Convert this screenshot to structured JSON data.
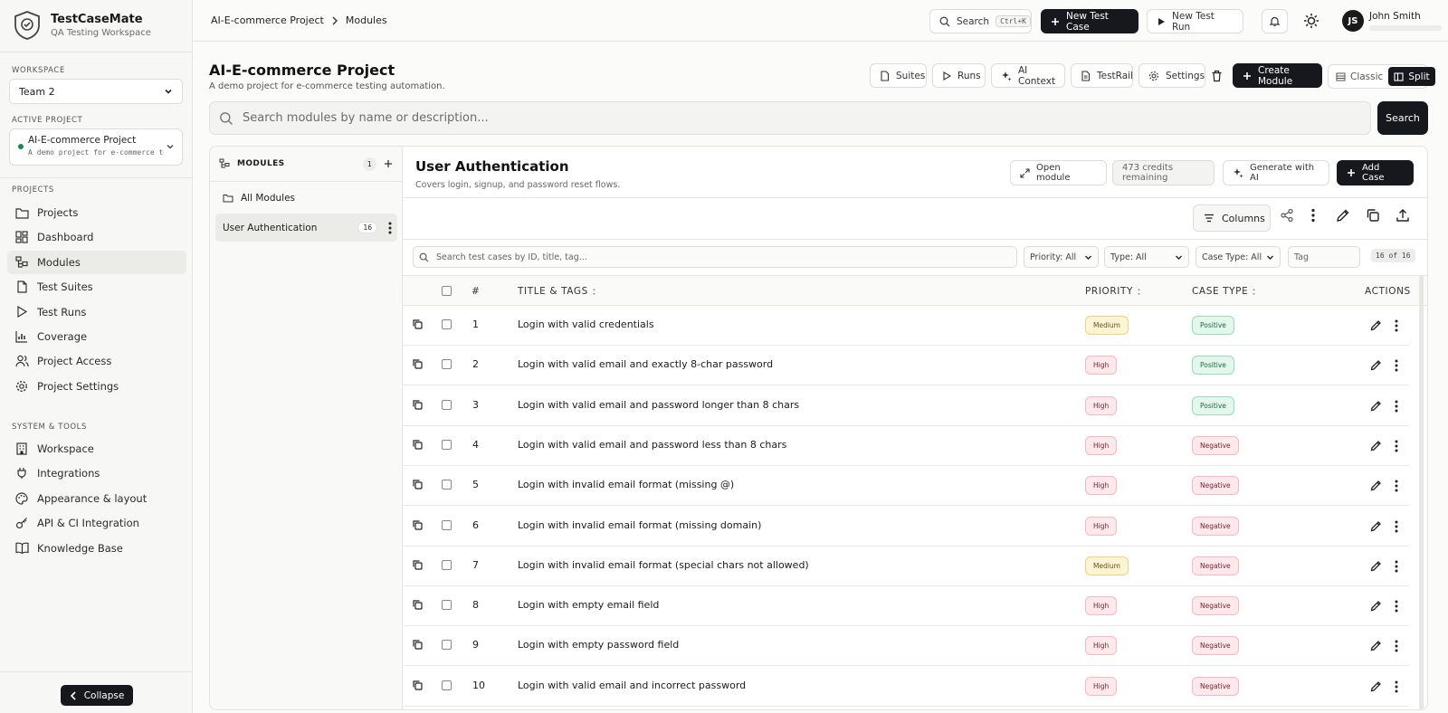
{
  "brand": {
    "name": "TestCaseMate",
    "subtitle": "QA Testing Workspace"
  },
  "sidebar": {
    "workspace_label": "WORKSPACE",
    "workspace_value": "Team 2",
    "active_project_label": "ACTIVE PROJECT",
    "active_project": {
      "name": "AI-E-commerce Project",
      "description": "A demo project for e-commerce testi..."
    },
    "projects_label": "PROJECTS",
    "project_items": [
      {
        "label": "Projects",
        "icon": "folder-icon"
      },
      {
        "label": "Dashboard",
        "icon": "dashboard-icon"
      },
      {
        "label": "Modules",
        "icon": "modules-icon"
      },
      {
        "label": "Test Suites",
        "icon": "suites-icon"
      },
      {
        "label": "Test Runs",
        "icon": "play-icon"
      },
      {
        "label": "Coverage",
        "icon": "chart-icon"
      },
      {
        "label": "Project Access",
        "icon": "users-icon"
      },
      {
        "label": "Project Settings",
        "icon": "gear-icon"
      }
    ],
    "system_label": "SYSTEM & TOOLS",
    "system_items": [
      {
        "label": "Workspace",
        "icon": "building-icon"
      },
      {
        "label": "Integrations",
        "icon": "plug-icon"
      },
      {
        "label": "Appearance & layout",
        "icon": "palette-icon"
      },
      {
        "label": "API & CI Integration",
        "icon": "key-icon"
      },
      {
        "label": "Knowledge Base",
        "icon": "book-icon"
      }
    ],
    "collapse_label": "Collapse"
  },
  "topbar": {
    "breadcrumb": [
      "AI-E-commerce Project",
      "Modules"
    ],
    "search_label": "Search",
    "search_kbd": "Ctrl+K",
    "new_test_case": "New Test Case",
    "new_test_run": "New Test Run",
    "user_initials": "JS",
    "user_name": "John Smith"
  },
  "project": {
    "title": "AI-E-commerce Project",
    "subtitle": "A demo project for e-commerce testing automation.",
    "buttons": {
      "suites": "Suites",
      "runs": "Runs",
      "ai_context": "AI Context",
      "testrail": "TestRail",
      "settings": "Settings",
      "create_module": "Create Module",
      "classic": "Classic",
      "split": "Split"
    },
    "search_placeholder": "Search modules by name or description...",
    "search_button": "Search"
  },
  "modules": {
    "header": "MODULES",
    "count": "1",
    "all_label": "All Modules",
    "items": [
      {
        "label": "User Authentication",
        "count": "16"
      }
    ]
  },
  "module_view": {
    "title": "User Authentication",
    "subtitle": "Covers login, signup, and password reset flows.",
    "open_module": "Open module",
    "credits": "473 credits remaining",
    "generate": "Generate with AI",
    "add_case": "Add Case",
    "columns": "Columns",
    "search_placeholder": "Search test cases by ID, title, tag...",
    "filters": {
      "priority": "Priority: All",
      "type": "Type: All",
      "case_type": "Case Type: All",
      "tag_placeholder": "Tag"
    },
    "count": "16 of 16",
    "headers": {
      "num": "#",
      "title": "TITLE & TAGS",
      "priority": "PRIORITY",
      "case_type": "CASE TYPE",
      "actions": "ACTIONS"
    },
    "rows": [
      {
        "num": "1",
        "title": "Login with valid credentials",
        "priority": "Medium",
        "case_type": "Positive"
      },
      {
        "num": "2",
        "title": "Login with valid email and exactly 8-char password",
        "priority": "High",
        "case_type": "Positive"
      },
      {
        "num": "3",
        "title": "Login with valid email and password longer than 8 chars",
        "priority": "High",
        "case_type": "Positive"
      },
      {
        "num": "4",
        "title": "Login with valid email and password less than 8 chars",
        "priority": "High",
        "case_type": "Negative"
      },
      {
        "num": "5",
        "title": "Login with invalid email format (missing @)",
        "priority": "High",
        "case_type": "Negative"
      },
      {
        "num": "6",
        "title": "Login with invalid email format (missing domain)",
        "priority": "High",
        "case_type": "Negative"
      },
      {
        "num": "7",
        "title": "Login with invalid email format (special chars not allowed)",
        "priority": "Medium",
        "case_type": "Negative"
      },
      {
        "num": "8",
        "title": "Login with empty email field",
        "priority": "High",
        "case_type": "Negative"
      },
      {
        "num": "9",
        "title": "Login with empty password field",
        "priority": "High",
        "case_type": "Negative"
      },
      {
        "num": "10",
        "title": "Login with valid email and incorrect password",
        "priority": "High",
        "case_type": "Negative"
      }
    ]
  }
}
